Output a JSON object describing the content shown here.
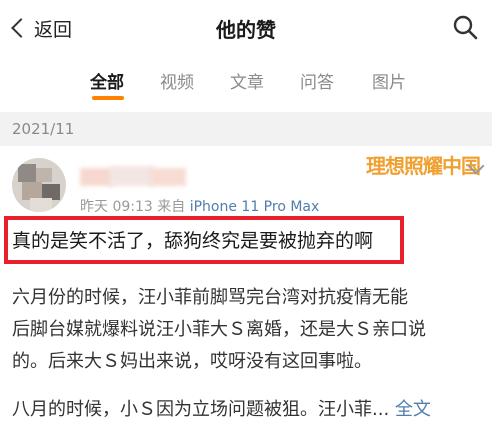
{
  "header": {
    "back_label": "返回",
    "title": "他的赞"
  },
  "tabs": [
    "全部",
    "视频",
    "文章",
    "问答",
    "图片"
  ],
  "date_section": "2021/11",
  "post": {
    "time": "昨天 09:13",
    "source_prefix": "来自",
    "device": "iPhone 11 Pro Max",
    "watermark": "理想照耀中国",
    "highlight": "真的是笑不活了，舔狗终究是要被抛弃的啊",
    "para1_lines": [
      "六月份的时候，汪小菲前脚骂完台湾对抗疫情无能",
      "后脚台媒就爆料说汪小菲大Ｓ离婚，还是大Ｓ亲口说",
      "的。后来大Ｓ妈出来说，哎呀没有这回事啦。"
    ],
    "para2": "八月的时候，小Ｓ因为立场问题被狙。汪小菲...",
    "fulltext_label": "全文"
  },
  "colors": {
    "accent": "#ff8200",
    "link": "#507daf",
    "highlight_border": "#e8202b",
    "watermark": "#f0a030"
  }
}
